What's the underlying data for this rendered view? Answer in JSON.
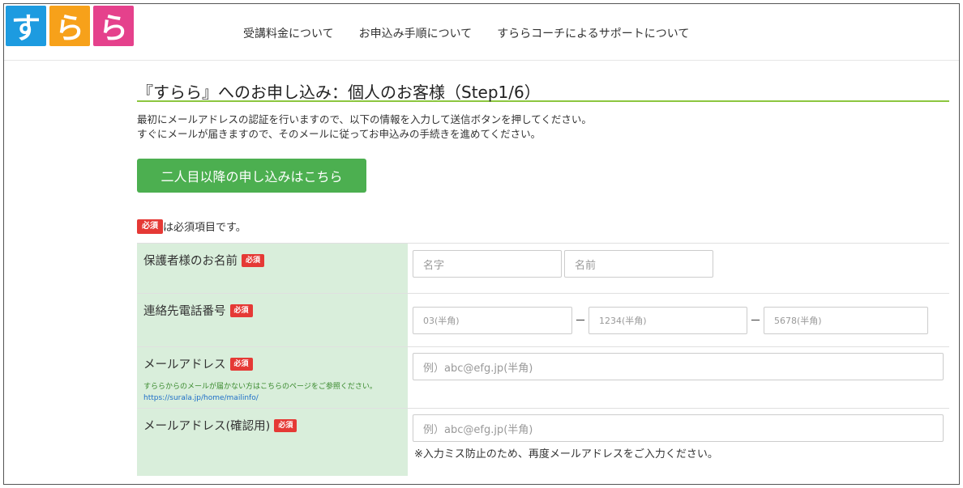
{
  "header": {
    "logo": {
      "tiles": [
        {
          "char": "す",
          "color": "#1d9be0"
        },
        {
          "char": "ら",
          "color": "#f7a11a"
        },
        {
          "char": "ら",
          "color": "#e5418c"
        }
      ]
    },
    "nav": [
      "受講料金について",
      "お申込み手順について",
      "すららコーチによるサポートについて"
    ]
  },
  "title": "『すらら』へのお申し込み：個人のお客様（Step1/6）",
  "intro": [
    "最初にメールアドレスの認証を行いますので、以下の情報を入力して送信ボタンを押してください。",
    "すぐにメールが届きますので、そのメールに従ってお申込みの手続きを進めてください。"
  ],
  "second_child_button": "二人目以降の申し込みはこちら",
  "required_badge": "必須",
  "required_note": "は必須項目です。",
  "form": {
    "guardian_name": {
      "label": "保護者様のお名前",
      "last_placeholder": "名字",
      "first_placeholder": "名前"
    },
    "phone": {
      "label": "連絡先電話番号",
      "p1_placeholder": "03(半角)",
      "p2_placeholder": "1234(半角)",
      "p3_placeholder": "5678(半角)",
      "separator": "－"
    },
    "email": {
      "label": "メールアドレス",
      "placeholder": "例）abc@efg.jp(半角)",
      "help": "すららからのメールが届かない方はこちらのページをご参照ください。",
      "help_link": "https://surala.jp/home/mailinfo/"
    },
    "email_confirm": {
      "label": "メールアドレス(確認用)",
      "placeholder": "例）abc@efg.jp(半角)",
      "note": "※入力ミス防止のため、再度メールアドレスをご入力ください。"
    }
  },
  "colors": {
    "accent_green": "#4caf50",
    "title_underline": "#8cc63f",
    "label_bg": "#d9eedb",
    "required_red": "#e53935"
  }
}
